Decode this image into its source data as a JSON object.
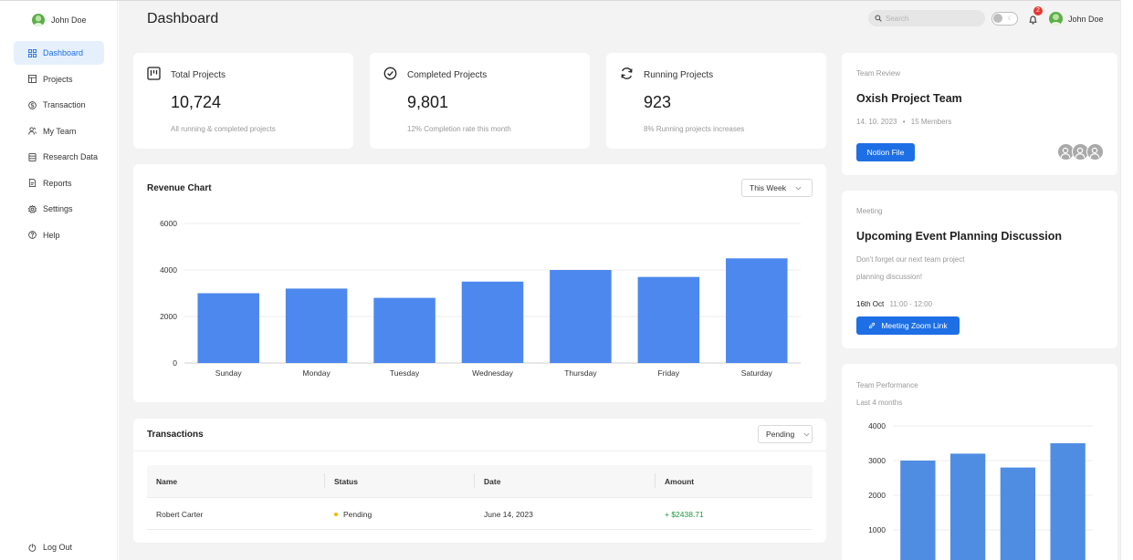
{
  "user": {
    "name": "John Doe"
  },
  "sidebar": {
    "items": [
      {
        "label": "Dashboard",
        "icon": "grid-icon",
        "active": true
      },
      {
        "label": "Projects",
        "icon": "kanban-icon"
      },
      {
        "label": "Transaction",
        "icon": "currency-icon"
      },
      {
        "label": "My Team",
        "icon": "team-icon"
      },
      {
        "label": "Research Data",
        "icon": "database-icon"
      },
      {
        "label": "Reports",
        "icon": "report-icon"
      },
      {
        "label": "Settings",
        "icon": "gear-icon"
      },
      {
        "label": "Help",
        "icon": "help-icon"
      }
    ],
    "logout_label": "Log Out"
  },
  "header": {
    "title": "Dashboard",
    "search_placeholder": "Search",
    "notification_count": "2",
    "user_name": "John Doe"
  },
  "stats": [
    {
      "title": "Total Projects",
      "value": "10,724",
      "sub": "All running & completed projects",
      "icon": "kanban-board-icon"
    },
    {
      "title": "Completed Projects",
      "value": "9,801",
      "sub": "12% Completion rate this month",
      "icon": "check-circle-icon"
    },
    {
      "title": "Running Projects",
      "value": "923",
      "sub": "8% Running projects increases",
      "icon": "refresh-icon"
    }
  ],
  "revenue": {
    "title": "Revenue Chart",
    "range_label": "This Week"
  },
  "transactions": {
    "title": "Transactions",
    "filter_label": "Pending",
    "columns": [
      "Name",
      "Status",
      "Date",
      "Amount"
    ],
    "rows": [
      {
        "name": "Robert Carter",
        "status": "Pending",
        "date": "June 14, 2023",
        "amount": "+ $2438.71"
      }
    ]
  },
  "team_review": {
    "label": "Team Review",
    "team": "Oxish Project Team",
    "date": "14. 10. 2023",
    "members": "15 Members",
    "button": "Notion File"
  },
  "meeting": {
    "label": "Meeting",
    "title": "Upcoming Event Planning Discussion",
    "line1": "Don't forget our next team project",
    "line2": "planning discussion!",
    "date": "16th Oct",
    "time": "11:00 - 12:00",
    "button": "Meeting Zoom Link"
  },
  "performance": {
    "label": "Team Performance",
    "sub": "Last 4 months"
  },
  "colors": {
    "accent": "#1e6fe6",
    "bar": "#4c88ee",
    "bar2": "#4f8de3",
    "positive": "#1d9a3f",
    "pending": "#f5b800"
  },
  "chart_data": [
    {
      "type": "bar",
      "title": "Revenue Chart",
      "categories": [
        "Sunday",
        "Monday",
        "Tuesday",
        "Wednesday",
        "Thursday",
        "Friday",
        "Saturday"
      ],
      "values": [
        3000,
        3200,
        2800,
        3500,
        4000,
        3700,
        4500
      ],
      "yticks": [
        0,
        2000,
        4000,
        6000
      ],
      "ylim": [
        0,
        6000
      ],
      "grid": true
    },
    {
      "type": "bar",
      "title": "Team Performance",
      "categories": [
        "",
        "",
        "",
        ""
      ],
      "values": [
        3000,
        3200,
        2800,
        3500
      ],
      "yticks": [
        1000,
        2000,
        3000,
        4000
      ],
      "ylim": [
        0,
        4000
      ],
      "grid": true
    }
  ]
}
